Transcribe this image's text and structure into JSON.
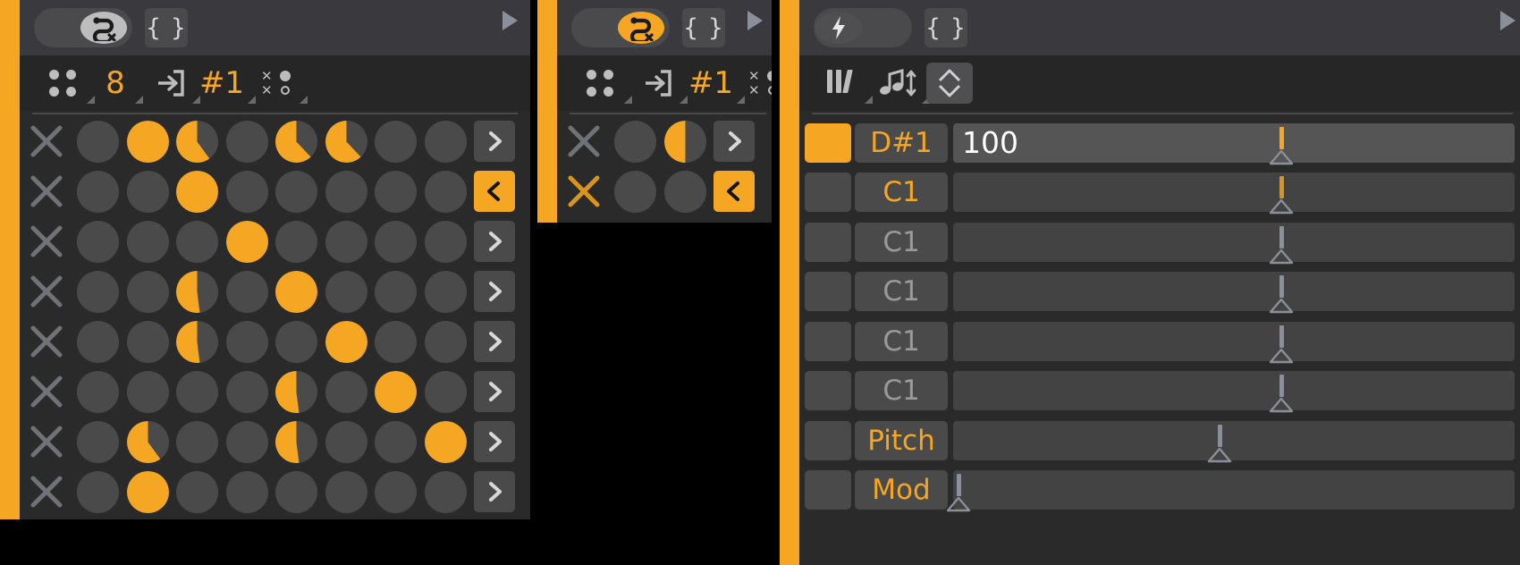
{
  "app": {
    "name": "step-sequencer-trigger-editor",
    "colors": {
      "accent": "#f5a623",
      "accent_dark": "#d9941a",
      "panel_bg": "#2a2a2a",
      "header_bg": "#3a3a3e",
      "toolbar_bg": "#262626",
      "cell_off": "#4a4a4a",
      "text_dim": "#9a9a9a",
      "text_bright": "#ffffff",
      "backdrop": "#000000"
    }
  },
  "left_panel": {
    "header": {
      "mode_toggle": {
        "icon": "snake-trig-off-icon",
        "state": "off",
        "label": ""
      },
      "braces_button": {
        "icon": "curly-braces-icon",
        "label": "{ }"
      },
      "play_button": {
        "icon": "play-triangle-icon",
        "label": ""
      }
    },
    "toolbar": {
      "items": [
        {
          "icon": "four-dot-grid-icon",
          "label": "",
          "type": "icon"
        },
        {
          "icon": "",
          "label": "8",
          "type": "number"
        },
        {
          "icon": "import-arrow-icon",
          "label": "",
          "type": "icon"
        },
        {
          "icon": "",
          "label": "#1",
          "type": "number"
        },
        {
          "icon": "x-o-dots-icon",
          "label": "",
          "type": "icon"
        }
      ]
    },
    "grid": {
      "rows": 8,
      "cols": 8,
      "clear_icon": "x-clear-icon",
      "row_arrow_right": ">",
      "row_arrow_left": "<",
      "active_arrow_row": 2,
      "cells": [
        [
          0,
          100,
          60,
          0,
          62,
          62,
          0,
          0
        ],
        [
          0,
          0,
          100,
          0,
          0,
          0,
          0,
          0
        ],
        [
          0,
          0,
          0,
          100,
          0,
          0,
          0,
          0
        ],
        [
          0,
          0,
          52,
          0,
          100,
          0,
          0,
          0
        ],
        [
          0,
          0,
          52,
          0,
          0,
          100,
          0,
          0
        ],
        [
          0,
          0,
          0,
          0,
          52,
          0,
          100,
          0
        ],
        [
          0,
          60,
          0,
          0,
          52,
          0,
          0,
          100
        ],
        [
          0,
          100,
          0,
          0,
          0,
          0,
          0,
          0
        ]
      ]
    }
  },
  "mid_panel": {
    "header": {
      "mode_toggle": {
        "icon": "snake-trig-on-icon",
        "state": "on",
        "label": ""
      },
      "braces_button": {
        "icon": "curly-braces-icon",
        "label": "{ }"
      },
      "play_button": {
        "icon": "play-triangle-icon",
        "label": ""
      }
    },
    "toolbar": {
      "items": [
        {
          "icon": "four-dot-grid-icon",
          "label": "",
          "type": "icon"
        },
        {
          "icon": "import-arrow-icon",
          "label": "",
          "type": "icon"
        },
        {
          "icon": "",
          "label": "#1",
          "type": "number"
        },
        {
          "icon": "x-o-dots-icon",
          "label": "",
          "type": "icon"
        }
      ]
    },
    "grid": {
      "rows": 2,
      "cols": 2,
      "clear_icon": "x-clear-icon",
      "row_arrow_right": ">",
      "row_arrow_left": "<",
      "active_arrow_row": 2,
      "row_clear_active": 2,
      "cells": [
        [
          0,
          50
        ],
        [
          0,
          0
        ]
      ]
    }
  },
  "right_panel": {
    "header": {
      "mode_toggle": {
        "icon": "lightning-bolt-icon",
        "state": "off",
        "label": ""
      },
      "braces_button": {
        "icon": "curly-braces-icon",
        "label": "{ }"
      },
      "play_button": {
        "icon": "play-triangle-icon",
        "label": ""
      }
    },
    "toolbar": {
      "items": [
        {
          "icon": "piano-keys-icon",
          "label": "",
          "type": "icon"
        },
        {
          "icon": "note-transpose-icon",
          "label": "",
          "type": "icon"
        },
        {
          "icon": "up-down-chevron-icon",
          "label": "",
          "type": "icon",
          "selected": true
        }
      ]
    },
    "lanes": [
      {
        "swatch": "on",
        "name": "D#1",
        "value": "100",
        "value_lit": true,
        "slider_pct": 58.5,
        "slider_state": "on"
      },
      {
        "swatch": "off",
        "name": "C1",
        "value": "",
        "value_lit": false,
        "slider_pct": 58.5,
        "slider_state": "on2"
      },
      {
        "swatch": "off",
        "name": "C1",
        "value": "",
        "value_lit": false,
        "slider_pct": 58.5,
        "slider_state": "off"
      },
      {
        "swatch": "off",
        "name": "C1",
        "value": "",
        "value_lit": false,
        "slider_pct": 58.5,
        "slider_state": "off"
      },
      {
        "swatch": "off",
        "name": "C1",
        "value": "",
        "value_lit": false,
        "slider_pct": 58.5,
        "slider_state": "off"
      },
      {
        "swatch": "off",
        "name": "C1",
        "value": "",
        "value_lit": false,
        "slider_pct": 58.5,
        "slider_state": "off"
      },
      {
        "swatch": "off",
        "name": "Pitch",
        "value": "",
        "value_lit": false,
        "slider_pct": 47.5,
        "slider_state": "off"
      },
      {
        "swatch": "off",
        "name": "Mod",
        "value": "",
        "value_lit": false,
        "slider_pct": 1.0,
        "slider_state": "off"
      }
    ]
  }
}
